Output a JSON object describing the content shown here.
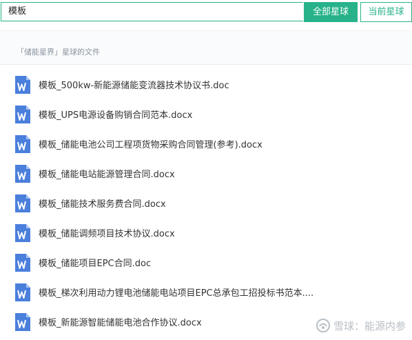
{
  "search": {
    "query": "模板",
    "all_planets_label": "全部星球",
    "current_planet_label": "当前星球"
  },
  "subheader": {
    "text": "「储能星界」星球的文件"
  },
  "files": [
    {
      "name": "模板_500kw-新能源储能变流器技术协议书.doc",
      "icon": "word-doc-icon"
    },
    {
      "name": "模板_UPS电源设备购销合同范本.docx",
      "icon": "word-doc-icon"
    },
    {
      "name": "模板_储能电池公司工程项货物采购合同管理(参考).docx",
      "icon": "word-doc-icon"
    },
    {
      "name": "模板_储能电站能源管理合同.docx",
      "icon": "word-doc-icon"
    },
    {
      "name": "模板_储能技术服务费合同.docx",
      "icon": "word-doc-icon"
    },
    {
      "name": "模板_储能调频项目技术协议.docx",
      "icon": "word-doc-icon"
    },
    {
      "name": "模板_储能项目EPC合同.doc",
      "icon": "word-doc-icon"
    },
    {
      "name": "模板_梯次利用动力锂电池储能电站项目EPC总承包工招投标书范本....",
      "icon": "word-doc-icon"
    },
    {
      "name": "模板_新能源智能储能电池合作协议.docx",
      "icon": "word-doc-icon"
    }
  ],
  "watermark": {
    "text": "雪球：能源内参",
    "icon": "snowball-logo-icon"
  },
  "colors": {
    "accent": "#27b28a",
    "word_icon": "#4a7fdc"
  }
}
